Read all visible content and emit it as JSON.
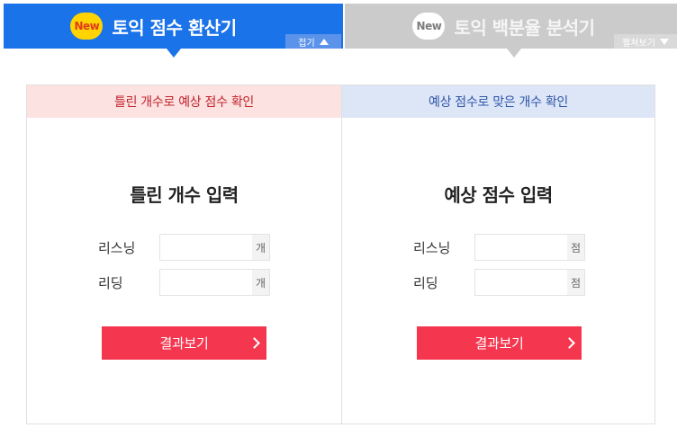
{
  "tabs": {
    "active": {
      "badge": "New",
      "title": "토익 점수 환산기",
      "toggle_label": "접기"
    },
    "inactive": {
      "badge": "New",
      "title": "토익 백분율 분석기",
      "toggle_label": "펼쳐보기"
    }
  },
  "left_panel": {
    "header": "틀린 개수로 예상 점수 확인",
    "title": "틀린 개수 입력",
    "fields": [
      {
        "label": "리스닝",
        "value": "",
        "unit": "개"
      },
      {
        "label": "리딩",
        "value": "",
        "unit": "개"
      }
    ],
    "button": "결과보기"
  },
  "right_panel": {
    "header": "예상 점수로 맞은 개수 확인",
    "title": "예상 점수 입력",
    "fields": [
      {
        "label": "리스닝",
        "value": "",
        "unit": "점"
      },
      {
        "label": "리딩",
        "value": "",
        "unit": "점"
      }
    ],
    "button": "결과보기"
  },
  "colors": {
    "active_tab": "#1a73e8",
    "inactive_tab": "#cbcbcb",
    "badge_yellow": "#ffd400",
    "button_red": "#f5364f",
    "left_header_bg": "#fde2e2",
    "right_header_bg": "#dde6f7"
  },
  "icons": {
    "collapse": "triangle-up-icon",
    "expand": "triangle-down-icon",
    "button_arrow": "chevron-right-icon"
  }
}
